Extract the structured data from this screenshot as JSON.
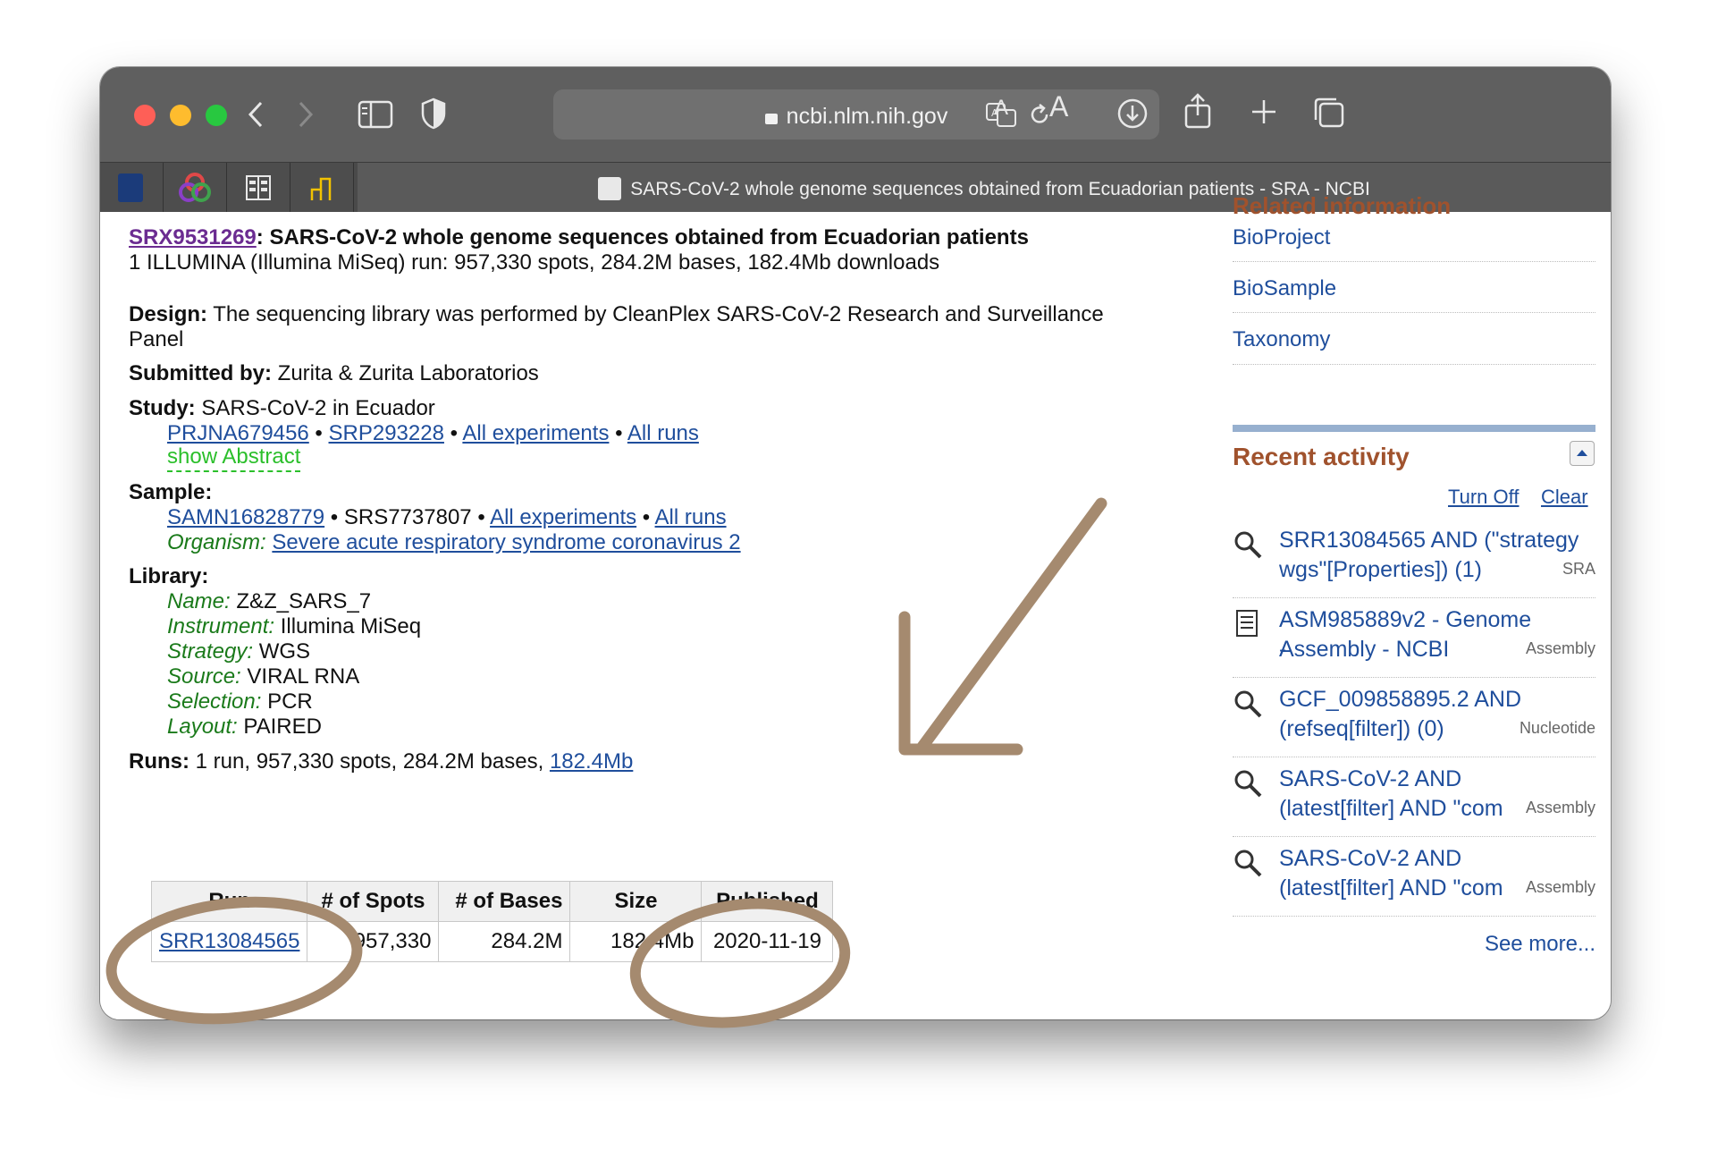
{
  "browser": {
    "address": "ncbi.nlm.nih.gov",
    "tab_title": "SARS-CoV-2 whole genome sequences obtained from Ecuadorian patients - SRA - NCBI",
    "text_small_label": "A",
    "text_large_label": "A"
  },
  "record": {
    "accession": "SRX9531269",
    "title": ": SARS-CoV-2 whole genome sequences obtained from Ecuadorian patients",
    "summary": "1 ILLUMINA (Illumina MiSeq) run: 957,330 spots, 284.2M bases, 182.4Mb downloads",
    "design_label": "Design:",
    "design_line1": " The sequencing library was performed by CleanPlex SARS-CoV-2 Research and Surveillance",
    "design_line2": "Panel",
    "submitted_label": "Submitted by:",
    "submitted_value": " Zurita & Zurita Laboratorios",
    "study_label": "Study:",
    "study_value": " SARS-CoV-2 in Ecuador",
    "study_links": [
      "PRJNA679456",
      "SRP293228",
      "All experiments",
      "All runs"
    ],
    "show_abstract": "show Abstract",
    "sample_label": "Sample:",
    "sample_link": "SAMN16828779",
    "sample_srs": " • SRS7737807 • ",
    "sample_links": [
      "All experiments",
      "All runs"
    ],
    "organism_label": "Organism:",
    "organism_value": "Severe acute respiratory syndrome coronavirus 2",
    "library_label": "Library:",
    "library": [
      {
        "label": "Name:",
        "value": " Z&Z_SARS_7"
      },
      {
        "label": "Instrument:",
        "value": " Illumina MiSeq"
      },
      {
        "label": "Strategy:",
        "value": " WGS"
      },
      {
        "label": "Source:",
        "value": " VIRAL RNA"
      },
      {
        "label": "Selection:",
        "value": " PCR"
      },
      {
        "label": "Layout:",
        "value": " PAIRED"
      }
    ],
    "runs_label": "Runs:",
    "runs_summary": " 1 run, 957,330 spots, 284.2M bases, ",
    "runs_size_link": "182.4Mb",
    "table": {
      "headers": [
        "Run",
        "# of Spots",
        "# of Bases",
        "Size",
        "Published"
      ],
      "row": {
        "run": "SRR13084565",
        "spots": "957,330",
        "bases": "284.2M",
        "size": "182.4Mb",
        "published": "2020-11-19"
      }
    }
  },
  "sidebar": {
    "related_heading": "Related information",
    "related_links": [
      "BioProject",
      "BioSample",
      "Taxonomy"
    ],
    "recent_heading": "Recent activity",
    "turn_off": "Turn Off",
    "clear": "Clear",
    "items": [
      {
        "icon": "search-icon",
        "line1": "SRR13084565 AND (\"strategy",
        "line2": "wgs\"[Properties]) (1)",
        "db": "SRA"
      },
      {
        "icon": "document-icon",
        "line1": "ASM985889v2 - Genome -",
        "line2": "Assembly - NCBI",
        "db": "Assembly"
      },
      {
        "icon": "search-icon",
        "line1": "GCF_009858895.2 AND",
        "line2": "(refseq[filter]) (0)",
        "db": "Nucleotide"
      },
      {
        "icon": "search-icon",
        "line1": "SARS-CoV-2 AND",
        "line2": "(latest[filter] AND \"com",
        "db": "Assembly"
      },
      {
        "icon": "search-icon",
        "line1": "SARS-CoV-2 AND",
        "line2": "(latest[filter] AND \"com",
        "db": "Assembly"
      }
    ],
    "see_more": "See more..."
  },
  "colors": {
    "link": "#1f4e9c",
    "visited": "#6b2c91",
    "recent_heading": "#a0522d",
    "annotation": "#a58a6f",
    "show_abstract": "#2bbf2b"
  }
}
